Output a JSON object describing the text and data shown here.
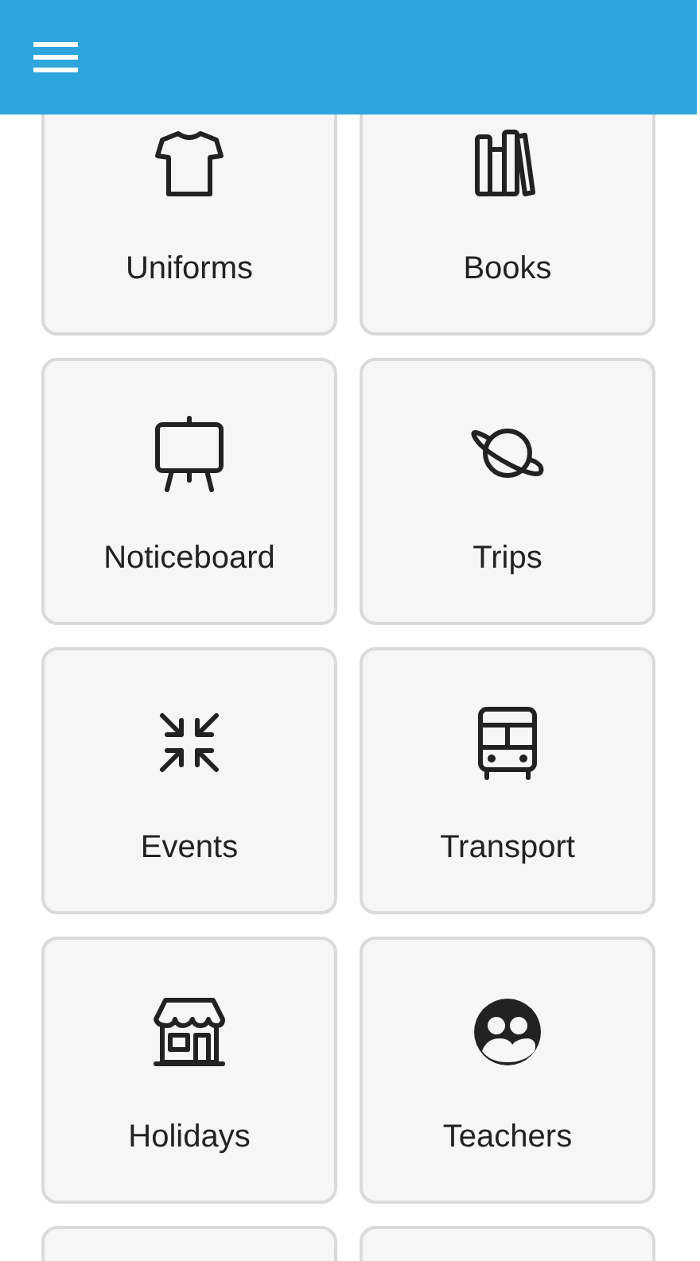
{
  "tiles": [
    {
      "kind": "tile",
      "label": "Uniforms"
    },
    {
      "kind": "tile",
      "label": "Books"
    },
    {
      "kind": "tile",
      "label": "Noticeboard"
    },
    {
      "kind": "tile",
      "label": "Trips"
    },
    {
      "kind": "tile",
      "label": "Events"
    },
    {
      "kind": "tile",
      "label": "Transport"
    },
    {
      "kind": "tile",
      "label": "Holidays"
    },
    {
      "kind": "tile",
      "label": "Teachers"
    },
    {
      "kind": "tile_cut_off"
    },
    {
      "kind": "tile_cut_off"
    }
  ]
}
